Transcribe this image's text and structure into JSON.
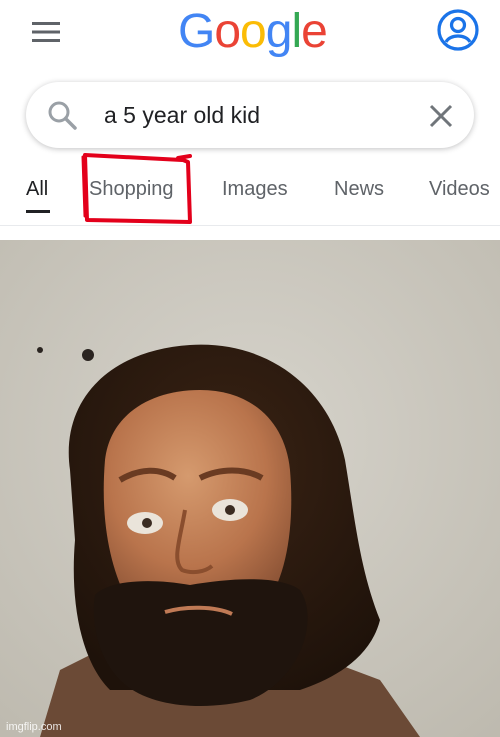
{
  "header": {
    "menu_icon": "hamburger-menu-icon",
    "logo": [
      "G",
      "o",
      "o",
      "g",
      "l",
      "e"
    ],
    "logo_colors": [
      "#4285F4",
      "#EA4335",
      "#FBBC05",
      "#4285F4",
      "#34A853",
      "#EA4335"
    ],
    "account_icon": "account-circle-icon",
    "accent": "#1a73e8"
  },
  "search": {
    "query": "a 5 year old kid",
    "search_icon": "search-icon",
    "clear_icon": "close-icon"
  },
  "tabs": [
    {
      "label": "All",
      "active": true
    },
    {
      "label": "Shopping",
      "active": false
    },
    {
      "label": "Images",
      "active": false
    },
    {
      "label": "News",
      "active": false
    },
    {
      "label": "Videos",
      "active": false
    }
  ],
  "annotation": {
    "color": "#e3001b",
    "target": "Shopping"
  },
  "photo": {
    "watermark": "imgflip.com"
  }
}
